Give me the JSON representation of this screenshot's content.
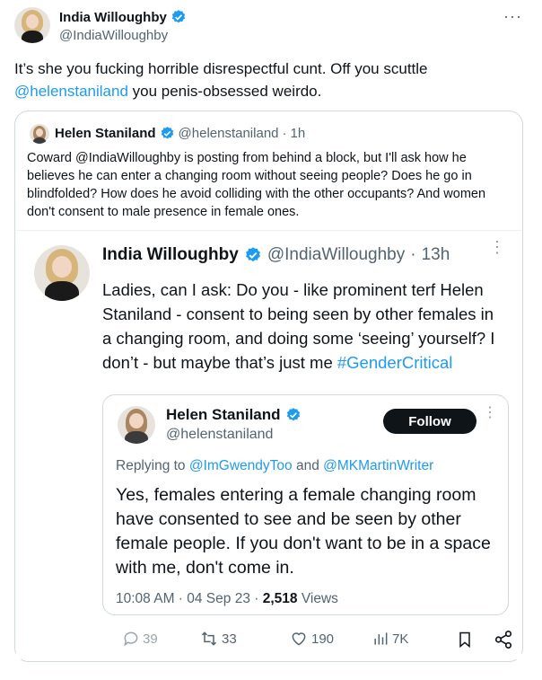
{
  "main_tweet": {
    "author_name": "India Willoughby",
    "author_handle": "@IndiaWilloughby",
    "more_label": "···",
    "text_part1": "It’s she you fucking horrible disrespectful cunt. Off you scuttle ",
    "mention": "@helenstaniland",
    "text_part2": " you penis-obsessed weirdo."
  },
  "quote_tweet": {
    "author_name": "Helen Staniland",
    "author_handle": "@helenstaniland",
    "separator": "·",
    "time": "1h",
    "text": "Coward @IndiaWilloughby is posting from behind a block, but I'll ask how he believes he can enter a changing room without seeing people? Does he go in blindfolded? How does he avoid colliding with the other occupants? And women don't consent to male presence in female ones."
  },
  "embedded_tweet": {
    "author_name": "India Willoughby",
    "author_handle": "@IndiaWilloughby",
    "separator": "·",
    "time": "13h",
    "more_label": "⋮",
    "text": "Ladies, can I ask: Do you - like prominent terf Helen Staniland - consent to being seen by other females in a changing room, and doing some ‘seeing’ yourself? I don’t - but maybe that’s just me ",
    "hashtag": "#GenderCritical",
    "actions": {
      "replies": "39",
      "retweets": "33",
      "likes": "190",
      "views": "7K"
    }
  },
  "nested_tweet": {
    "author_name": "Helen Staniland",
    "author_handle": "@helenstaniland",
    "follow_label": "Follow",
    "more_label": "⋮",
    "replying_prefix": "Replying to ",
    "reply_mention_1": "@ImGwendyToo",
    "reply_and": " and ",
    "reply_mention_2": "@MKMartinWriter",
    "text": "Yes, females entering a female changing room have consented to see and be seen by other female people. If you don't want to be in a space with me, don't come in.",
    "timestamp": "10:08 AM · 04 Sep 23 · ",
    "views_count": "2,518",
    "views_label": " Views"
  },
  "colors": {
    "link": "#1d9bf0",
    "verified": "#1d9bf0",
    "text": "#0f1419",
    "secondary": "#536471",
    "border": "#cfd9de"
  },
  "icons": [
    "verified-badge-icon",
    "more-icon",
    "reply-icon",
    "retweet-icon",
    "like-icon",
    "views-icon",
    "bookmark-icon",
    "share-icon"
  ]
}
